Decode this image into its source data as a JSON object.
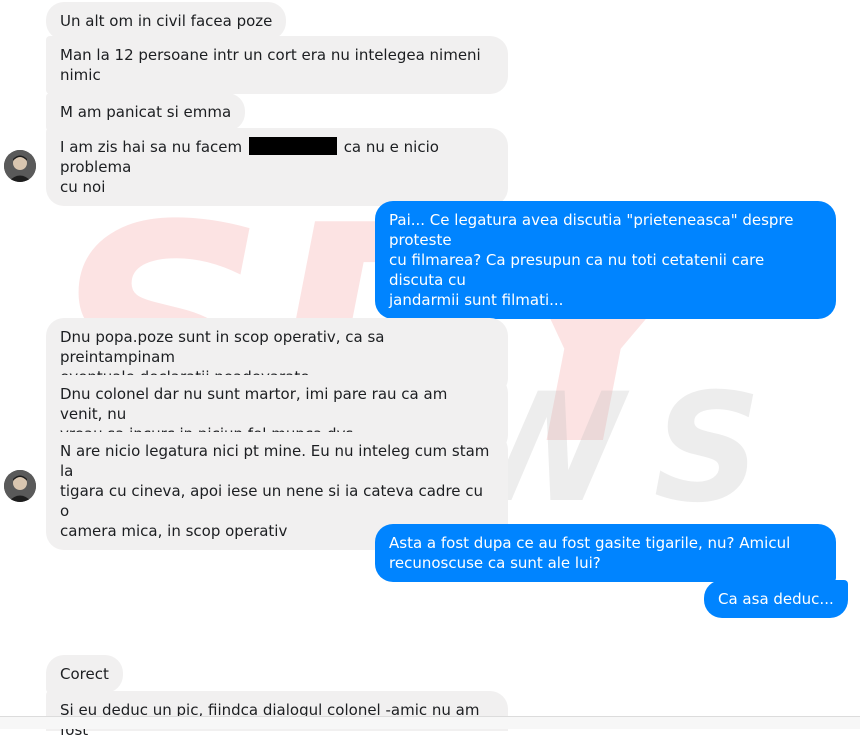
{
  "watermark": {
    "brand_top": "SPY",
    "brand_bottom": "NEWS",
    "color": "#e8262a"
  },
  "colors": {
    "incoming_bg": "#f1f0f0",
    "outgoing_bg": "#0084ff"
  },
  "messages": [
    {
      "side": "in",
      "text": "Un alt om in civil facea poze"
    },
    {
      "side": "in",
      "text": "Man la 12 persoane intr un cort era nu intelegea nimeni\nnimic"
    },
    {
      "side": "in",
      "text": "M am panicat si emma"
    },
    {
      "side": "in",
      "pre": "I am zis hai sa nu facem ",
      "post": " ca nu e nicio problema\ncu noi"
    },
    {
      "side": "out",
      "text": "Pai... Ce legatura avea discutia \"prieteneasca\" despre proteste\ncu filmarea? Ca presupun ca nu toti cetatenii care discuta cu\njandarmii sunt filmati..."
    },
    {
      "side": "in",
      "text": "Dnu popa.poze sunt in scop operativ, ca sa preintampinam\neventuale declaratii neadevarate"
    },
    {
      "side": "in",
      "text": "Dnu colonel dar nu sunt martor, imi pare rau ca am venit, nu\nvreau sa incurc in niciun fel munca dvs"
    },
    {
      "side": "in",
      "text": "N are nicio legatura nici pt mine. Eu nu inteleg cum stam la\ntigara cu cineva, apoi iese un nene si ia cateva cadre cu o\ncamera mica, in scop operativ"
    },
    {
      "side": "out",
      "text": "Asta a fost dupa ce au fost gasite tigarile, nu? Amicul\nrecunoscuse ca sunt ale lui?"
    },
    {
      "side": "out",
      "text": "Ca asa deduc..."
    },
    {
      "side": "in",
      "text": "Corect"
    },
    {
      "side": "in",
      "text": "Si eu deduc un pic, fiindca dialogul colonel -amic nu am fost"
    }
  ]
}
